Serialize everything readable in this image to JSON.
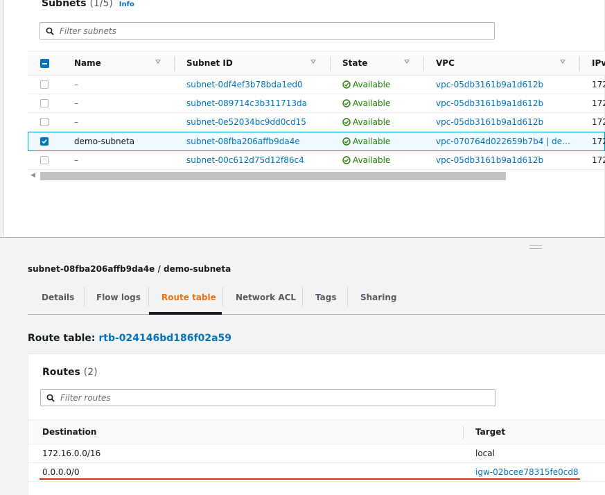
{
  "subnets_panel": {
    "title": "Subnets",
    "count": "(1/5)",
    "info": "Info",
    "filter_placeholder": "Filter subnets",
    "columns": [
      "Name",
      "Subnet ID",
      "State",
      "VPC",
      "IPv"
    ],
    "rows": [
      {
        "name": "–",
        "subnet_id": "subnet-0df4ef3b78bda1ed0",
        "state": "Available",
        "vpc": "vpc-05db3161b9a1d612b",
        "ipv": "172",
        "selected": false
      },
      {
        "name": "–",
        "subnet_id": "subnet-089714c3b311713da",
        "state": "Available",
        "vpc": "vpc-05db3161b9a1d612b",
        "ipv": "172",
        "selected": false
      },
      {
        "name": "–",
        "subnet_id": "subnet-0e52034bc9dd0cd15",
        "state": "Available",
        "vpc": "vpc-05db3161b9a1d612b",
        "ipv": "172",
        "selected": false
      },
      {
        "name": "demo-subneta",
        "subnet_id": "subnet-08fba206affb9da4e",
        "state": "Available",
        "vpc": "vpc-070764d022659b7b4 | de…",
        "ipv": "172",
        "selected": true
      },
      {
        "name": "–",
        "subnet_id": "subnet-00c612d75d12f86c4",
        "state": "Available",
        "vpc": "vpc-05db3161b9a1d612b",
        "ipv": "172",
        "selected": false
      }
    ]
  },
  "details": {
    "title": "subnet-08fba206affb9da4e / demo-subneta",
    "tabs": [
      "Details",
      "Flow logs",
      "Route table",
      "Network ACL",
      "Tags",
      "Sharing"
    ],
    "active_tab": "Route table"
  },
  "route_table": {
    "label": "Route table:",
    "id": "rtb-024146bd186f02a59",
    "routes_title": "Routes",
    "routes_count": "(2)",
    "filter_placeholder": "Filter routes",
    "columns": [
      "Destination",
      "Target"
    ],
    "rows": [
      {
        "destination": "172.16.0.0/16",
        "target": "local"
      },
      {
        "destination": "0.0.0.0/0",
        "target": "igw-02bcee78315fe0cd8"
      }
    ]
  },
  "colors": {
    "link": "#0073bb",
    "available": "#1d8102",
    "active_tab": "#ec7211",
    "annotation": "#d13212"
  }
}
